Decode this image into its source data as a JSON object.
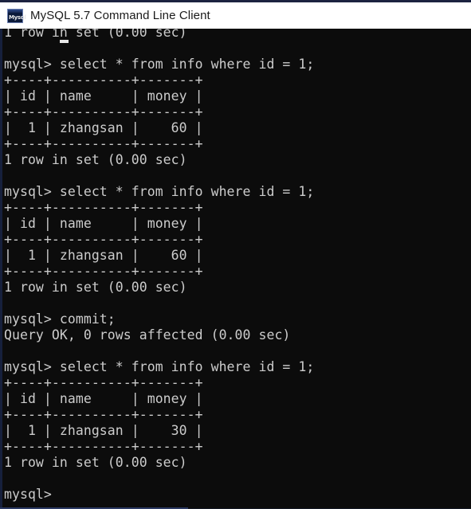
{
  "window": {
    "title": "MySQL 5.7 Command Line Client",
    "icon_name": "mysql-console-icon",
    "icon_glyph": "Mysql",
    "background_color": "#0c0c0c",
    "text_color": "#cccccc",
    "titlebar_color": "#ffffff"
  },
  "terminal": {
    "prompt": "mysql>",
    "cursor": "_",
    "lines": [
      "1 row in set (0.00 sec)",
      "",
      "mysql> select * from info where id = 1;",
      "+----+----------+-------+",
      "| id | name     | money |",
      "+----+----------+-------+",
      "|  1 | zhangsan |    60 |",
      "+----+----------+-------+",
      "1 row in set (0.00 sec)",
      "",
      "mysql> select * from info where id = 1;",
      "+----+----------+-------+",
      "| id | name     | money |",
      "+----+----------+-------+",
      "|  1 | zhangsan |    60 |",
      "+----+----------+-------+",
      "1 row in set (0.00 sec)",
      "",
      "mysql> commit;",
      "Query OK, 0 rows affected (0.00 sec)",
      "",
      "mysql> select * from info where id = 1;",
      "+----+----------+-------+",
      "| id | name     | money |",
      "+----+----------+-------+",
      "|  1 | zhangsan |    30 |",
      "+----+----------+-------+",
      "1 row in set (0.00 sec)",
      "",
      "mysql> "
    ],
    "queries": [
      "select * from info where id = 1;",
      "select * from info where id = 1;",
      "commit;",
      "select * from info where id = 1;"
    ],
    "result_tables": [
      {
        "columns": [
          "id",
          "name",
          "money"
        ],
        "rows": [
          [
            "1",
            "zhangsan",
            "60"
          ]
        ],
        "status": "1 row in set (0.00 sec)"
      },
      {
        "columns": [
          "id",
          "name",
          "money"
        ],
        "rows": [
          [
            "1",
            "zhangsan",
            "60"
          ]
        ],
        "status": "1 row in set (0.00 sec)"
      },
      {
        "columns": [
          "id",
          "name",
          "money"
        ],
        "rows": [
          [
            "1",
            "zhangsan",
            "30"
          ]
        ],
        "status": "1 row in set (0.00 sec)"
      }
    ],
    "commit_status": "Query OK, 0 rows affected (0.00 sec)"
  }
}
